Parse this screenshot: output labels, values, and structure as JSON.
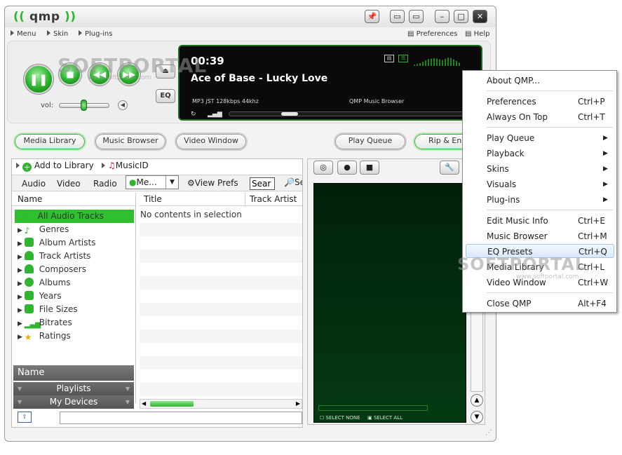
{
  "titlebar": {
    "logo": "qmp"
  },
  "menubar": {
    "menu": "Menu",
    "skin": "Skin",
    "plugins": "Plug-ins",
    "preferences": "Preferences",
    "help": "Help"
  },
  "player": {
    "time": "00:39",
    "track": "Ace of Base - Lucky Love",
    "format": "MP3 jST 128kbps 44khz",
    "browser_label": "QMP Music Browser",
    "volume_label": "vol:",
    "eq_label": "EQ",
    "volume_level": 0.5
  },
  "nav": {
    "media_library": "Media Library",
    "music_browser": "Music Browser",
    "video_window": "Video Window",
    "play_queue": "Play Queue",
    "rip_encode": "Rip & Enco"
  },
  "library": {
    "add_to_library": "Add to Library",
    "music_id": "MusicID",
    "tabs": [
      "Audio",
      "Video",
      "Radio"
    ],
    "media_select": "Me...",
    "view_prefs": "View Prefs",
    "search_placeholder": "Sear",
    "name_header": "Name",
    "title_header": "Title",
    "track_artist_header": "Track Artist",
    "no_contents": "No contents in selection",
    "tree": [
      "All Audio Tracks",
      "Genres",
      "Album Artists",
      "Track Artists",
      "Composers",
      "Albums",
      "Years",
      "File Sizes",
      "Bitrates",
      "Ratings"
    ],
    "bottom_name": "Name",
    "playlists": "Playlists",
    "my_devices": "My Devices"
  },
  "video": {
    "select_none": "SELECT NONE",
    "select_all": "SELECT ALL"
  },
  "context_menu": {
    "items": [
      {
        "label": "About QMP...",
        "shortcut": "",
        "submenu": false
      },
      {
        "label": "Preferences",
        "shortcut": "Ctrl+P",
        "submenu": false
      },
      {
        "label": "Always On Top",
        "shortcut": "Ctrl+T",
        "submenu": false
      },
      {
        "label": "Play Queue",
        "shortcut": "",
        "submenu": true
      },
      {
        "label": "Playback",
        "shortcut": "",
        "submenu": true
      },
      {
        "label": "Skins",
        "shortcut": "",
        "submenu": true
      },
      {
        "label": "Visuals",
        "shortcut": "",
        "submenu": true
      },
      {
        "label": "Plug-ins",
        "shortcut": "",
        "submenu": true
      },
      {
        "label": "Edit Music Info",
        "shortcut": "Ctrl+E",
        "submenu": false
      },
      {
        "label": "Music Browser",
        "shortcut": "Ctrl+M",
        "submenu": false
      },
      {
        "label": "EQ Presets",
        "shortcut": "Ctrl+Q",
        "submenu": false
      },
      {
        "label": "Media Library",
        "shortcut": "Ctrl+L",
        "submenu": false
      },
      {
        "label": "Video Window",
        "shortcut": "Ctrl+W",
        "submenu": false
      },
      {
        "label": "Close QMP",
        "shortcut": "Alt+F4",
        "submenu": false
      }
    ],
    "highlighted": "EQ Presets"
  },
  "watermark": {
    "text": "SOFTPORTAL",
    "url": "www.softportal.com"
  },
  "colors": {
    "accent": "#2fb52f",
    "display_bg": "#0a0a0a",
    "video_bg": "#032a0d"
  }
}
